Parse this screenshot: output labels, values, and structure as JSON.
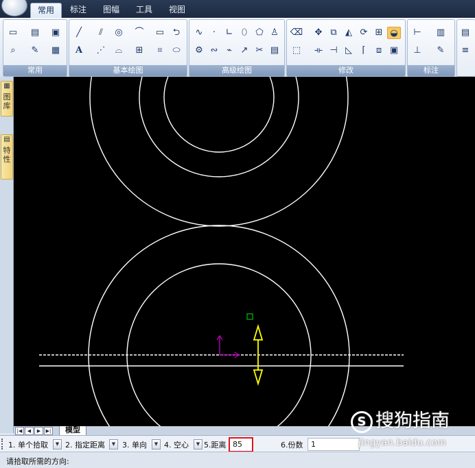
{
  "ribbon": {
    "tabs": [
      {
        "label": "常用",
        "active": true
      },
      {
        "label": "标注",
        "active": false
      },
      {
        "label": "图幅",
        "active": false
      },
      {
        "label": "工具",
        "active": false
      },
      {
        "label": "视图",
        "active": false
      }
    ],
    "groups": {
      "common": "常用",
      "basic_draw": "基本绘图",
      "advanced_draw": "高级绘图",
      "modify": "修改",
      "dimension": "标注"
    },
    "text_tool": "A"
  },
  "left_dock": {
    "tab1": {
      "icon": "drawing-tree-icon",
      "label": "图库"
    },
    "tab2": {
      "icon": "properties-icon",
      "label": "特性"
    }
  },
  "canvas": {
    "background": "#000000",
    "entity_color": "#ffffff",
    "arrow_color": "#ffff00",
    "ucs_color": "#c000c0",
    "snap_color": "#00c000"
  },
  "tabstrip": {
    "model_tab": "模型"
  },
  "command_bar": {
    "opt1": "1. 单个拾取",
    "opt2": "2. 指定距离",
    "opt3": "3. 单向",
    "opt4": "4. 空心",
    "opt5": "5.距离",
    "distance_value": "85",
    "opt6": "6.份数",
    "copies_value": "1",
    "highlight_color": "#e0141a"
  },
  "status": {
    "prompt": "请拾取所需的方向:"
  },
  "watermark": {
    "brand": "搜狗指南",
    "url": "jingyan.baidu.com"
  }
}
